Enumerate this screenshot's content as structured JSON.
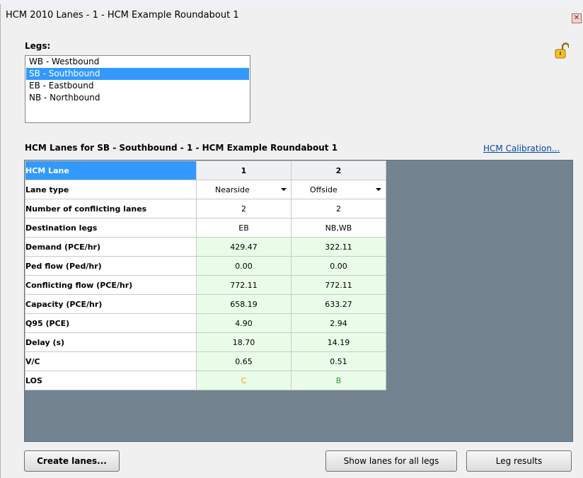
{
  "window": {
    "title": "HCM 2010 Lanes - 1 - HCM Example Roundabout 1",
    "close_glyph": "✕"
  },
  "legs": {
    "label": "Legs:",
    "items": [
      "WB - Westbound",
      "SB - Southbound",
      "EB - Eastbound",
      "NB - Northbound"
    ],
    "selected_index": 1
  },
  "lanes_section": {
    "title": "HCM Lanes for SB - Southbound - 1 - HCM Example Roundabout 1",
    "calibration_link": "HCM Calibration..."
  },
  "table": {
    "header_label": "HCM Lane",
    "lane_numbers": [
      "1",
      "2"
    ],
    "rows": [
      {
        "label": "Lane type",
        "values": [
          "Nearside",
          "Offside"
        ]
      },
      {
        "label": "Number of conflicting lanes",
        "values": [
          "2",
          "2"
        ]
      },
      {
        "label": "Destination legs",
        "values": [
          "EB",
          "NB,WB"
        ]
      },
      {
        "label": "Demand (PCE/hr)",
        "values": [
          "429.47",
          "322.11"
        ]
      },
      {
        "label": "Ped flow (Ped/hr)",
        "values": [
          "0.00",
          "0.00"
        ]
      },
      {
        "label": "Conflicting flow (PCE/hr)",
        "values": [
          "772.11",
          "772.11"
        ]
      },
      {
        "label": "Capacity (PCE/hr)",
        "values": [
          "658.19",
          "633.27"
        ]
      },
      {
        "label": "Q95 (PCE)",
        "values": [
          "4.90",
          "2.94"
        ]
      },
      {
        "label": "Delay (s)",
        "values": [
          "18.70",
          "14.19"
        ]
      },
      {
        "label": "V/C",
        "values": [
          "0.65",
          "0.51"
        ]
      },
      {
        "label": "LOS",
        "values": [
          "C",
          "B"
        ]
      }
    ]
  },
  "los_colors": {
    "C": "#ff9900",
    "B": "#2e9a2e"
  },
  "colors": {
    "selection": "#3399ff",
    "calc_cell": "#e9fce8",
    "grid_background": "#738490",
    "link": "#0645ad"
  },
  "buttons": {
    "create_lanes": "Create lanes...",
    "show_all_legs": "Show lanes for all legs",
    "leg_results": "Leg results"
  },
  "icons": {
    "lock": "unlocked-padlock-icon",
    "dropdown": "chevron-down-icon",
    "close": "close-icon"
  }
}
